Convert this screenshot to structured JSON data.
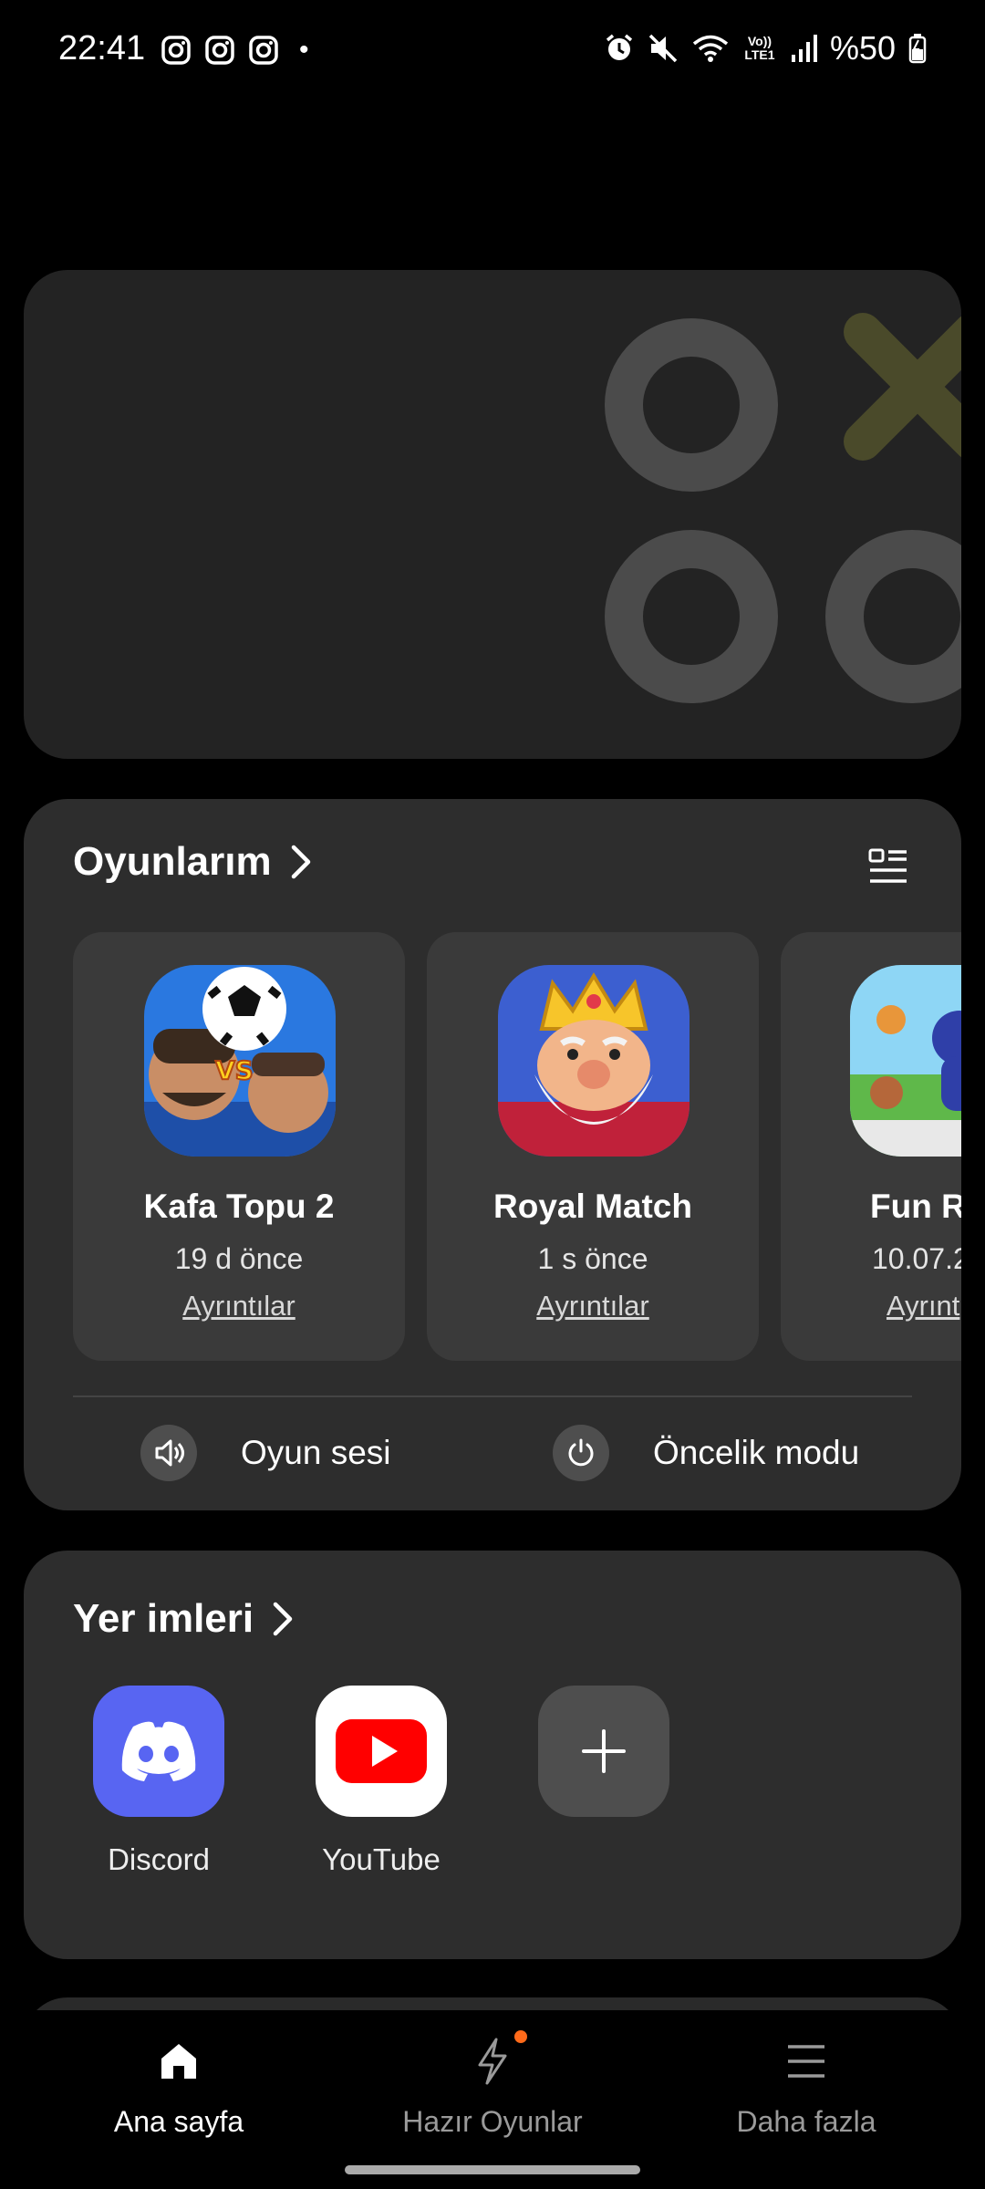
{
  "status_bar": {
    "time": "22:41",
    "notification_icons": [
      "instagram-icon",
      "instagram-icon",
      "instagram-icon"
    ],
    "dot": "•",
    "volte_label": "Vo)) LTE1",
    "battery_text": "%50"
  },
  "games": {
    "title": "Oyunlarım",
    "items": [
      {
        "name": "Kafa Topu 2",
        "last_played": "19 d önce",
        "details": "Ayrıntılar"
      },
      {
        "name": "Royal Match",
        "last_played": "1 s önce",
        "details": "Ayrıntılar"
      },
      {
        "name": "Fun R",
        "last_played": "10.07.2",
        "details": "Ayrınt"
      }
    ],
    "quick_actions": [
      {
        "label": "Oyun sesi",
        "icon": "speaker-icon"
      },
      {
        "label": "Öncelik modu",
        "icon": "power-icon"
      }
    ]
  },
  "bookmarks": {
    "title": "Yer imleri",
    "items": [
      {
        "label": "Discord",
        "icon": "discord-icon"
      },
      {
        "label": "YouTube",
        "icon": "youtube-icon"
      },
      {
        "label": "",
        "icon": "plus-icon"
      }
    ]
  },
  "bottom_nav": {
    "items": [
      {
        "label": "Ana sayfa",
        "icon": "home-icon",
        "active": true
      },
      {
        "label": "Hazır Oyunlar",
        "icon": "lightning-icon",
        "active": false
      },
      {
        "label": "Daha fazla",
        "icon": "menu-icon",
        "active": false
      }
    ]
  },
  "colors": {
    "background": "#000000",
    "card": "#2d2d2d",
    "tile": "#3a3a3a",
    "discord": "#5865f2",
    "youtube": "#ff0000",
    "notification_dot": "#ff6a1a"
  }
}
